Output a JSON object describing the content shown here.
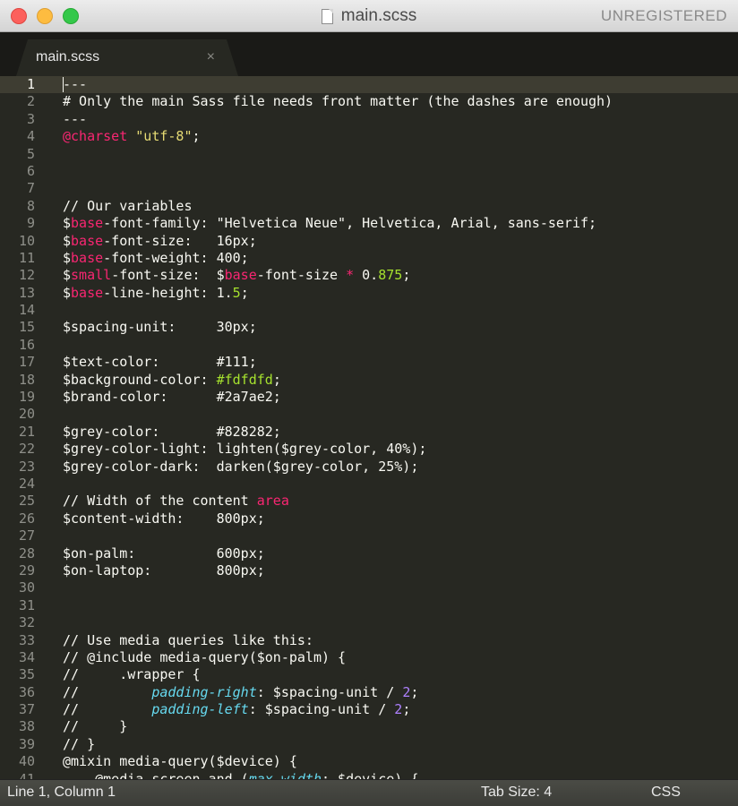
{
  "window": {
    "title": "main.scss",
    "unregistered": "UNREGISTERED"
  },
  "tab": {
    "label": "main.scss",
    "close_glyph": "×"
  },
  "status": {
    "position": "Line 1, Column 1",
    "tab_size": "Tab Size: 4",
    "syntax": "CSS"
  },
  "colors": {
    "background": "#272822",
    "text": "#f8f8f2",
    "keyword": "#f92672",
    "string": "#e6db74",
    "number": "#ae81ff",
    "green": "#a6e22e",
    "property": "#66d9ef",
    "line_number": "#8f908a"
  },
  "editor": {
    "current_line": 1,
    "lines": [
      [
        [
          "---",
          ""
        ]
      ],
      [
        [
          "# Only the main Sass file needs front matter (the dashes are enough)",
          ""
        ]
      ],
      [
        [
          "---",
          ""
        ]
      ],
      [
        [
          "@charset",
          "kw"
        ],
        [
          " ",
          ""
        ],
        [
          "\"utf-8\"",
          "str"
        ],
        [
          ";",
          ""
        ]
      ],
      [],
      [],
      [],
      [
        [
          "// Our variables",
          ""
        ]
      ],
      [
        [
          "$",
          ""
        ],
        [
          "base",
          "kw"
        ],
        [
          "-font-family: \"Helvetica Neue\", Helvetica, Arial, sans-serif;",
          ""
        ]
      ],
      [
        [
          "$",
          ""
        ],
        [
          "base",
          "kw"
        ],
        [
          "-font-size:   16px;",
          ""
        ]
      ],
      [
        [
          "$",
          ""
        ],
        [
          "base",
          "kw"
        ],
        [
          "-font-weight: 400;",
          ""
        ]
      ],
      [
        [
          "$",
          ""
        ],
        [
          "small",
          "kw"
        ],
        [
          "-font-size:  $",
          ""
        ],
        [
          "base",
          "kw"
        ],
        [
          "-font-size ",
          ""
        ],
        [
          "*",
          "kw"
        ],
        [
          " 0.",
          ""
        ],
        [
          "875",
          "green"
        ],
        [
          ";",
          ""
        ]
      ],
      [
        [
          "$",
          ""
        ],
        [
          "base",
          "kw"
        ],
        [
          "-line-height: 1.",
          ""
        ],
        [
          "5",
          "green"
        ],
        [
          ";",
          ""
        ]
      ],
      [],
      [
        [
          "$spacing-unit:     30px;",
          ""
        ]
      ],
      [],
      [
        [
          "$text-color:       #111;",
          ""
        ]
      ],
      [
        [
          "$background-color: ",
          ""
        ],
        [
          "#fdfdfd",
          "green"
        ],
        [
          ";",
          ""
        ]
      ],
      [
        [
          "$brand-color:      #2a7ae2;",
          ""
        ]
      ],
      [],
      [
        [
          "$grey-color:       #828282;",
          ""
        ]
      ],
      [
        [
          "$grey-color-light: lighten($grey-color, 40%);",
          ""
        ]
      ],
      [
        [
          "$grey-color-dark:  darken($grey-color, 25%);",
          ""
        ]
      ],
      [],
      [
        [
          "// Width of the content ",
          ""
        ],
        [
          "area",
          "kw"
        ]
      ],
      [
        [
          "$content-width:    800px;",
          ""
        ]
      ],
      [],
      [
        [
          "$on-palm:          600px;",
          ""
        ]
      ],
      [
        [
          "$on-laptop:        800px;",
          ""
        ]
      ],
      [],
      [],
      [],
      [
        [
          "// Use media queries like this:",
          ""
        ]
      ],
      [
        [
          "// @include media-query($on-palm) {",
          ""
        ]
      ],
      [
        [
          "//     .wrapper {",
          ""
        ]
      ],
      [
        [
          "//         ",
          ""
        ],
        [
          "padding-right",
          "prop"
        ],
        [
          ": $spacing-unit / ",
          ""
        ],
        [
          "2",
          "num"
        ],
        [
          ";",
          ""
        ]
      ],
      [
        [
          "//         ",
          ""
        ],
        [
          "padding-left",
          "prop"
        ],
        [
          ": $spacing-unit / ",
          ""
        ],
        [
          "2",
          "num"
        ],
        [
          ";",
          ""
        ]
      ],
      [
        [
          "//     }",
          ""
        ]
      ],
      [
        [
          "// }",
          ""
        ]
      ],
      [
        [
          "@mixin media-query($device) {",
          ""
        ]
      ],
      [
        [
          "    @media screen and (",
          ""
        ],
        [
          "max-width",
          "prop"
        ],
        [
          ": $device) {",
          ""
        ]
      ]
    ]
  }
}
